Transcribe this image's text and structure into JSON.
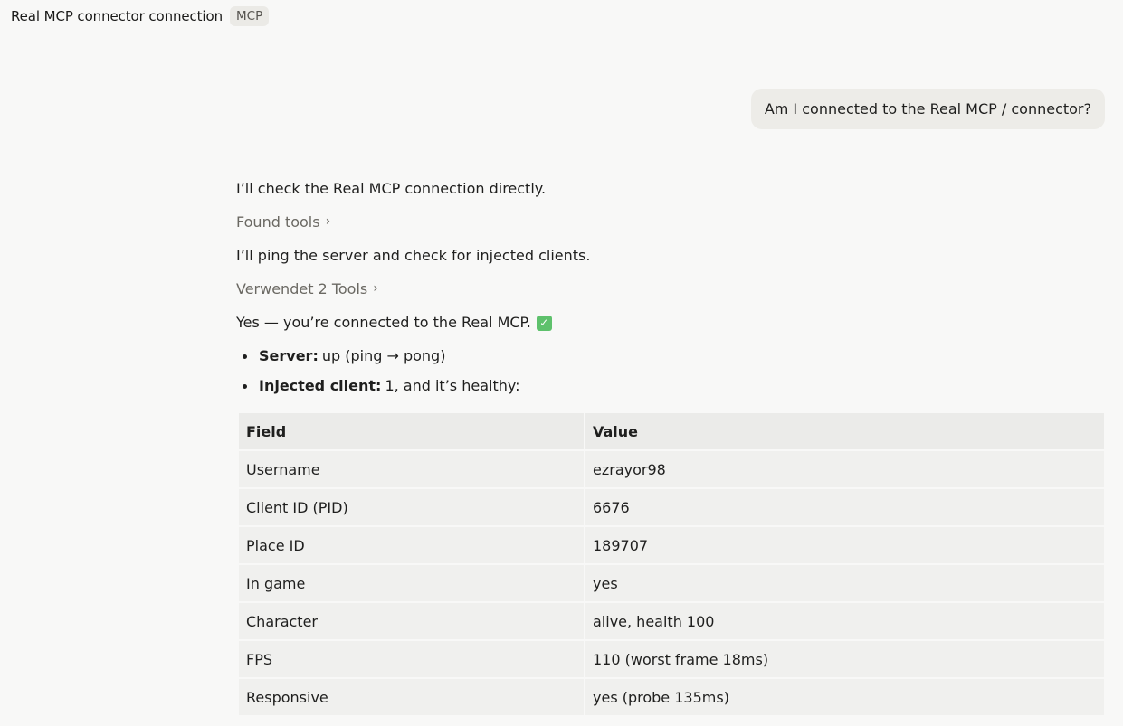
{
  "header": {
    "title": "Real MCP connector connection",
    "tag": "MCP"
  },
  "user_message": "Am I connected to the Real MCP / connector?",
  "assistant": {
    "line1": "I’ll check the Real MCP connection directly.",
    "tools1": "Found tools",
    "line2": "I’ll ping the server and check for injected clients.",
    "tools2": "Verwendet 2 Tools",
    "line3": "Yes — you’re connected to the Real MCP.",
    "check_icon": "white-check-mark-emoji",
    "bullets": [
      {
        "label": "Server:",
        "text": "up (ping → pong)"
      },
      {
        "label": "Injected client:",
        "text": "1, and it’s healthy:"
      }
    ]
  },
  "table": {
    "headers": [
      "Field",
      "Value"
    ],
    "rows": [
      [
        "Username",
        "ezrayor98"
      ],
      [
        "Client ID (PID)",
        "6676"
      ],
      [
        "Place ID",
        "189707"
      ],
      [
        "In game",
        "yes"
      ],
      [
        "Character",
        "alive, health 100"
      ],
      [
        "FPS",
        "110 (worst frame 18ms)"
      ],
      [
        "Responsive",
        "yes (probe 135ms)"
      ]
    ]
  }
}
